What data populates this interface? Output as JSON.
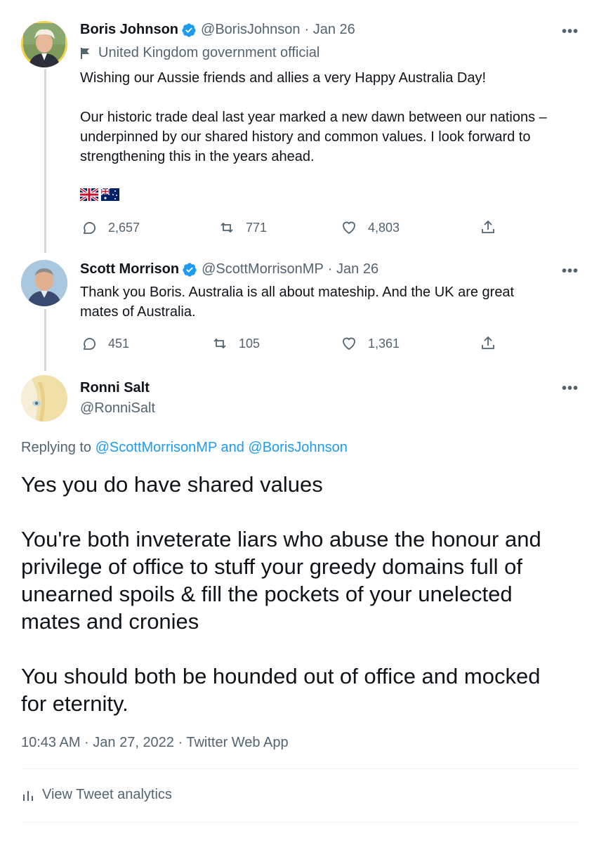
{
  "tweets": [
    {
      "name": "Boris Johnson",
      "handle": "@BorisJohnson",
      "date": "· Jan 26",
      "label": "United Kingdom government official",
      "p1": "Wishing our Aussie friends and allies a very Happy Australia Day!",
      "p2a": "Our historic trade deal last year marked a new dawn between our nations –",
      "p2b": "underpinned by our shared history and common values. I look forward to",
      "p2c": "strengthening this in the years ahead.",
      "replies": "2,657",
      "retweets": "771",
      "likes": "4,803"
    },
    {
      "name": "Scott Morrison",
      "handle": "@ScottMorrisonMP",
      "date": "· Jan 26",
      "p1": "Thank you Boris. Australia is all about mateship. And the UK are great",
      "p1b": "mates of Australia.",
      "replies": "451",
      "retweets": "105",
      "likes": "1,361"
    }
  ],
  "main": {
    "name": "Ronni Salt",
    "handle": "@RonniSalt",
    "replying_prefix": "Replying to ",
    "replying_to": "@ScottMorrisonMP and @BorisJohnson",
    "l1": "Yes you do have shared values",
    "l2": "You're both inveterate liars who abuse the honour and",
    "l3": "privilege of office to stuff your greedy domains full of",
    "l4": "unearned spoils & fill the pockets of your unelected",
    "l5": "mates and cronies",
    "l6": "You should both be hounded out of office and mocked",
    "l7": "for eternity.",
    "timestamp": "10:43 AM · Jan 27, 2022 · Twitter Web App",
    "analytics": "View Tweet analytics"
  },
  "more_glyph": "•••",
  "colors": {
    "accent": "#1d9bf0",
    "muted": "#536471",
    "line": "#cfd9de"
  }
}
